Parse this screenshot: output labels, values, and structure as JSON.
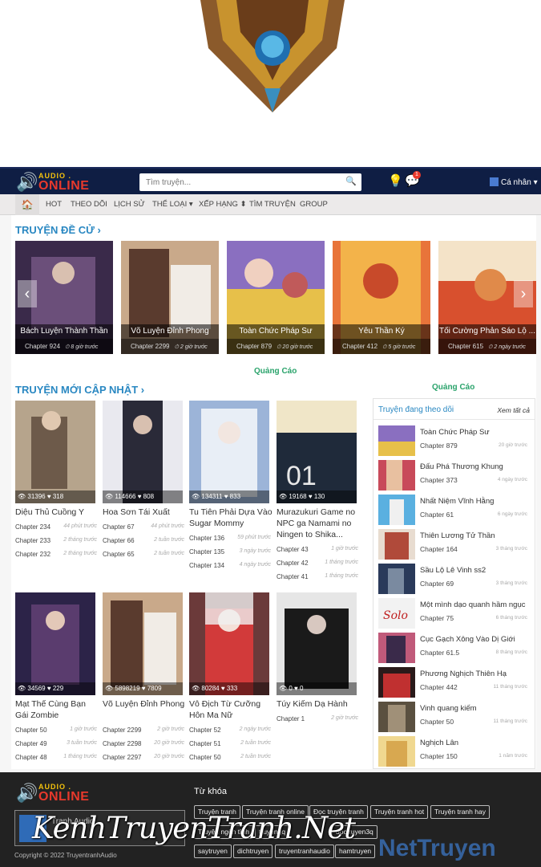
{
  "header": {
    "brand_top": "AUDIO .",
    "brand_main": "ONLINE",
    "search_placeholder": "Tìm truyện...",
    "notif_count": "1",
    "user_label": "Cá nhân ▾"
  },
  "nav": {
    "items": [
      "HOT",
      "THEO DÕI",
      "LỊCH SỬ",
      "THỂ LOẠI ▾",
      "XẾP HẠNG ⬍",
      "TÌM TRUYỆN",
      "GROUP"
    ]
  },
  "recommended": {
    "title": "TRUYỆN ĐỀ CỬ ›",
    "items": [
      {
        "name": "Bách Luyện Thành Thần",
        "chapter": "Chapter 924",
        "time": "⏱ 8 giờ trước"
      },
      {
        "name": "Võ Luyện Đỉnh Phong",
        "chapter": "Chapter 2299",
        "time": "⏱ 2 giờ trước"
      },
      {
        "name": "Toàn Chức Pháp Sư",
        "chapter": "Chapter 879",
        "time": "⏱ 20 giờ trước"
      },
      {
        "name": "Yêu Thần Ký",
        "chapter": "Chapter 412",
        "time": "⏱ 5 giờ trước"
      },
      {
        "name": "Tối Cường Phản Sáo Lộ ...",
        "chapter": "Chapter 615",
        "time": "⏱ 2 ngày trước"
      }
    ]
  },
  "ads": {
    "label1": "Quảng Cáo",
    "label2": "Quảng Cáo"
  },
  "latest": {
    "title": "TRUYỆN MỚI CẬP NHẬT ›",
    "items": [
      {
        "name": "Diệu Thủ Cuồng Y",
        "stats": "👁 31396 ♥ 318",
        "chapters": [
          [
            "Chapter 234",
            "44 phút trước"
          ],
          [
            "Chapter 233",
            "2 tháng trước"
          ],
          [
            "Chapter 232",
            "2 tháng trước"
          ]
        ]
      },
      {
        "name": "Hoa Sơn Tái Xuất",
        "stats": "👁 114666 ♥ 808",
        "chapters": [
          [
            "Chapter 67",
            "44 phút trước"
          ],
          [
            "Chapter 66",
            "2 tuần trước"
          ],
          [
            "Chapter 65",
            "2 tuần trước"
          ]
        ]
      },
      {
        "name": "Tu Tiên Phải Dựa Vào Sugar Mommy",
        "stats": "👁 134311 ♥ 833",
        "chapters": [
          [
            "Chapter 136",
            "59 phút trước"
          ],
          [
            "Chapter 135",
            "3 ngày trước"
          ],
          [
            "Chapter 134",
            "4 ngày trước"
          ]
        ]
      },
      {
        "name": "Murazukuri Game no NPC ga Namami no Ningen to Shika...",
        "stats": "👁 19168 ♥ 130",
        "chapters": [
          [
            "Chapter 43",
            "1 giờ trước"
          ],
          [
            "Chapter 42",
            "1 tháng trước"
          ],
          [
            "Chapter 41",
            "1 tháng trước"
          ]
        ]
      },
      {
        "name": "Mạt Thế Cùng Bạn Gái Zombie",
        "stats": "👁 34569 ♥ 229",
        "chapters": [
          [
            "Chapter 50",
            "1 giờ trước"
          ],
          [
            "Chapter 49",
            "3 tuần trước"
          ],
          [
            "Chapter 48",
            "1 tháng trước"
          ]
        ]
      },
      {
        "name": "Võ Luyện Đỉnh Phong",
        "stats": "👁 5898219 ♥ 7809",
        "chapters": [
          [
            "Chapter 2299",
            "2 giờ trước"
          ],
          [
            "Chapter 2298",
            "20 giờ trước"
          ],
          [
            "Chapter 2297",
            "20 giờ trước"
          ]
        ]
      },
      {
        "name": "Vô Địch Từ Cưỡng Hôn Ma Nữ",
        "stats": "👁 80284 ♥ 333",
        "chapters": [
          [
            "Chapter 52",
            "2 ngày trước"
          ],
          [
            "Chapter 51",
            "2 tuần trước"
          ],
          [
            "Chapter 50",
            "2 tuần trước"
          ]
        ]
      },
      {
        "name": "Túy Kiếm Dạ Hành",
        "stats": "👁 0 ♥ 0",
        "chapters": [
          [
            "Chapter 1",
            "2 giờ trước"
          ]
        ]
      }
    ]
  },
  "following": {
    "title": "Truyện đang theo dõi",
    "see_all": "Xem tất cả",
    "items": [
      {
        "name": "Toàn Chức Pháp Sư",
        "chapter": "Chapter 879",
        "time": "20 giờ trước"
      },
      {
        "name": "Đấu Phá Thương Khung",
        "chapter": "Chapter 373",
        "time": "4 ngày trước"
      },
      {
        "name": "Nhất Niệm Vĩnh Hằng",
        "chapter": "Chapter 61",
        "time": "6 ngày trước"
      },
      {
        "name": "Thiên Lương Tử Thần",
        "chapter": "Chapter 164",
        "time": "3 tháng trước"
      },
      {
        "name": "Sầu Lộ Lê Vinh ss2",
        "chapter": "Chapter 69",
        "time": "3 tháng trước"
      },
      {
        "name": "Một mình dạo quanh hầm ngục",
        "chapter": "Chapter 75",
        "time": "6 tháng trước"
      },
      {
        "name": "Cục Gạch Xông Vào Dị Giới",
        "chapter": "Chapter 61.5",
        "time": "8 tháng trước"
      },
      {
        "name": "Phương Nghịch Thiên Hạ",
        "chapter": "Chapter 442",
        "time": "11 tháng trước"
      },
      {
        "name": "Vinh quang kiếm",
        "chapter": "Chapter 50",
        "time": "11 tháng trước"
      },
      {
        "name": "Nghịch Lân",
        "chapter": "Chapter 150",
        "time": "1 năm trước"
      }
    ]
  },
  "footer": {
    "keywords_title": "Từ khóa",
    "tags": [
      "Truyện tranh",
      "Truyện tranh online",
      "Đọc truyện tranh",
      "Truyện tranh hot",
      "Truyện tranh hay",
      "Truyện ngôn tình",
      "truyenqq",
      "doctruyen3q",
      "",
      "",
      "",
      "saytruyen",
      "dichtruyen",
      "truyentranhaudio",
      "hamtruyen",
      "",
      ""
    ],
    "fanpage": "Tranh Audio",
    "copyright": "Copyright © 2022 TruyentranhAudio"
  },
  "watermark": {
    "text1": "KenhTruyenTranh.Net",
    "text2": "NetTruyen"
  }
}
